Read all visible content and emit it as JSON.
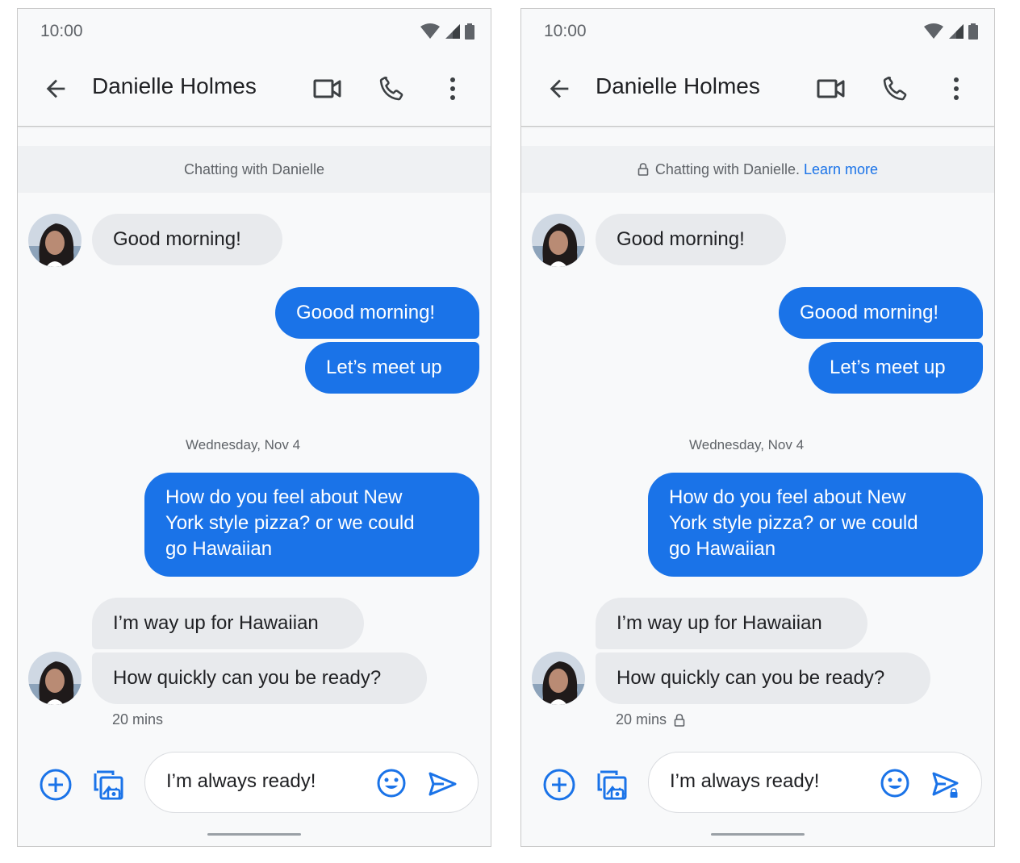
{
  "status_bar": {
    "time": "10:00"
  },
  "app_bar": {
    "contact_name": "Danielle Holmes"
  },
  "left_panel": {
    "banner_text": "Chatting with Danielle",
    "timestamp": "20 mins"
  },
  "right_panel": {
    "banner_text": "Chatting with Danielle.",
    "banner_link": "Learn more",
    "timestamp": "20 mins"
  },
  "messages": {
    "m1": "Good morning!",
    "m2": "Goood morning!",
    "m3": "Let’s meet up",
    "date": "Wednesday, Nov 4",
    "m4": "How do you feel about New\nYork style pizza? or we could\ngo Hawaiian",
    "m5": "I’m way up for Hawaiian",
    "m6": "How quickly can you be ready?"
  },
  "compose": {
    "text": "I’m always ready!"
  },
  "colors": {
    "accent": "#1a73e8",
    "incoming_bubble": "#e8eaed",
    "background": "#f8f9fa"
  },
  "icons": [
    "arrow-back-icon",
    "videocam-icon",
    "phone-icon",
    "more-vert-icon",
    "wifi-icon",
    "signal-icon",
    "battery-icon",
    "lock-icon",
    "add-circle-icon",
    "gallery-icon",
    "emoji-icon",
    "send-icon",
    "send-encrypted-icon"
  ]
}
